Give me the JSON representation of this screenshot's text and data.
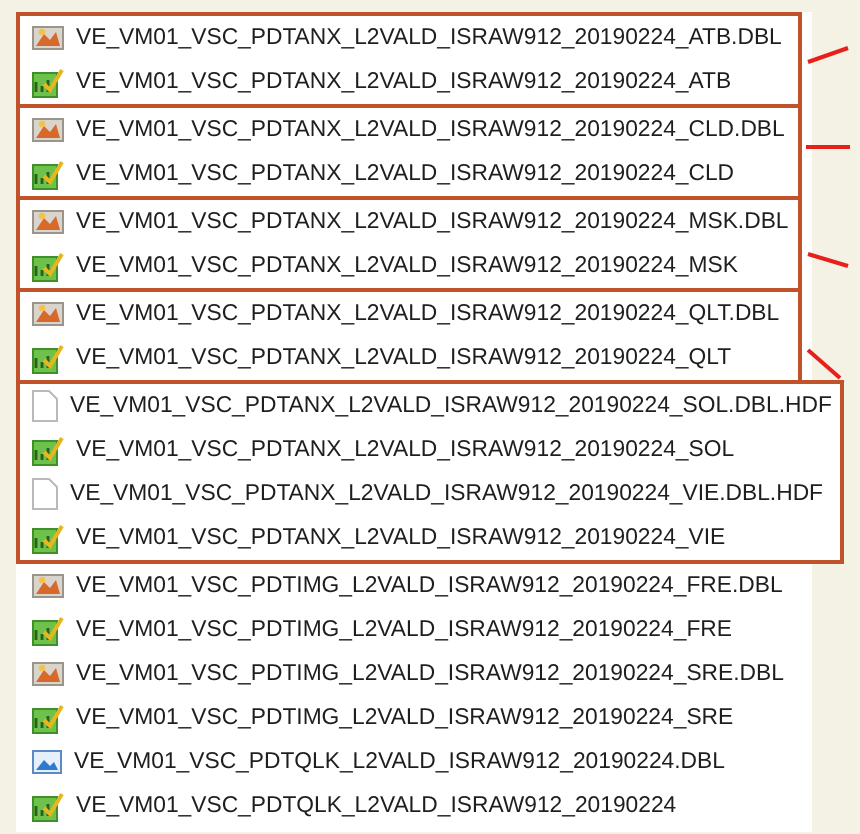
{
  "groups": [
    {
      "boxed": true,
      "pointer": true,
      "files": [
        {
          "kind": "dbl",
          "name": "VE_VM01_VSC_PDTANX_L2VALD_ISRAW912_20190224_ATB.DBL"
        },
        {
          "kind": "product",
          "name": "VE_VM01_VSC_PDTANX_L2VALD_ISRAW912_20190224_ATB"
        }
      ]
    },
    {
      "boxed": true,
      "pointer": true,
      "files": [
        {
          "kind": "dbl",
          "name": "VE_VM01_VSC_PDTANX_L2VALD_ISRAW912_20190224_CLD.DBL"
        },
        {
          "kind": "product",
          "name": "VE_VM01_VSC_PDTANX_L2VALD_ISRAW912_20190224_CLD"
        }
      ]
    },
    {
      "boxed": true,
      "pointer": true,
      "files": [
        {
          "kind": "dbl",
          "name": "VE_VM01_VSC_PDTANX_L2VALD_ISRAW912_20190224_MSK.DBL"
        },
        {
          "kind": "product",
          "name": "VE_VM01_VSC_PDTANX_L2VALD_ISRAW912_20190224_MSK"
        }
      ]
    },
    {
      "boxed": true,
      "pointer": true,
      "files": [
        {
          "kind": "dbl",
          "name": "VE_VM01_VSC_PDTANX_L2VALD_ISRAW912_20190224_QLT.DBL"
        },
        {
          "kind": "product",
          "name": "VE_VM01_VSC_PDTANX_L2VALD_ISRAW912_20190224_QLT"
        }
      ]
    },
    {
      "boxed": true,
      "pointer": false,
      "files": [
        {
          "kind": "blank",
          "name": "VE_VM01_VSC_PDTANX_L2VALD_ISRAW912_20190224_SOL.DBL.HDF"
        },
        {
          "kind": "product",
          "name": "VE_VM01_VSC_PDTANX_L2VALD_ISRAW912_20190224_SOL"
        },
        {
          "kind": "blank",
          "name": "VE_VM01_VSC_PDTANX_L2VALD_ISRAW912_20190224_VIE.DBL.HDF"
        },
        {
          "kind": "product",
          "name": "VE_VM01_VSC_PDTANX_L2VALD_ISRAW912_20190224_VIE"
        }
      ]
    },
    {
      "boxed": false,
      "pointer": false,
      "files": [
        {
          "kind": "dbl",
          "name": "VE_VM01_VSC_PDTIMG_L2VALD_ISRAW912_20190224_FRE.DBL"
        },
        {
          "kind": "product",
          "name": "VE_VM01_VSC_PDTIMG_L2VALD_ISRAW912_20190224_FRE"
        },
        {
          "kind": "dbl",
          "name": "VE_VM01_VSC_PDTIMG_L2VALD_ISRAW912_20190224_SRE.DBL"
        },
        {
          "kind": "product",
          "name": "VE_VM01_VSC_PDTIMG_L2VALD_ISRAW912_20190224_SRE"
        },
        {
          "kind": "image",
          "name": "VE_VM01_VSC_PDTQLK_L2VALD_ISRAW912_20190224.DBL"
        },
        {
          "kind": "product",
          "name": "VE_VM01_VSC_PDTQLK_L2VALD_ISRAW912_20190224"
        }
      ]
    }
  ]
}
